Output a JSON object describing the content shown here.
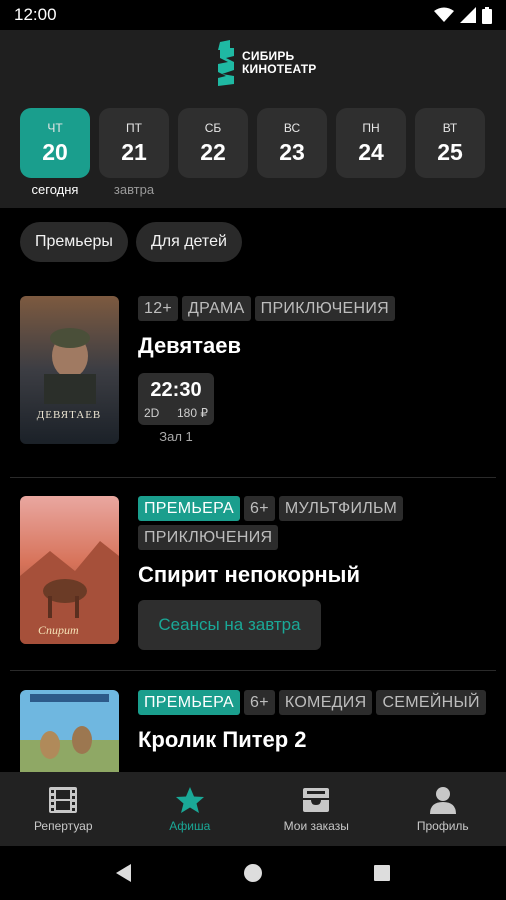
{
  "status": {
    "time": "12:00"
  },
  "logo": {
    "line1": "СИБИРЬ",
    "line2": "КИНОТЕАТР"
  },
  "dates": [
    {
      "dow": "ЧТ",
      "day": "20",
      "caption": "сегодня",
      "active": true
    },
    {
      "dow": "ПТ",
      "day": "21",
      "caption": "завтра",
      "active": false
    },
    {
      "dow": "СБ",
      "day": "22",
      "caption": "",
      "active": false
    },
    {
      "dow": "ВС",
      "day": "23",
      "caption": "",
      "active": false
    },
    {
      "dow": "ПН",
      "day": "24",
      "caption": "",
      "active": false
    },
    {
      "dow": "ВТ",
      "day": "25",
      "caption": "",
      "active": false
    }
  ],
  "filters": [
    "Премьеры",
    "Для детей"
  ],
  "movies": [
    {
      "tags": [
        "12+",
        "ДРАМА",
        "ПРИКЛЮЧЕНИЯ"
      ],
      "title": "Девятаев",
      "session": {
        "time": "22:30",
        "format": "2D",
        "price": "180 ₽",
        "hall": "Зал 1"
      },
      "poster_text": "ДЕВЯТАЕВ"
    },
    {
      "premiere": "ПРЕМЬЕРА",
      "tags": [
        "6+",
        "МУЛЬТФИЛЬМ",
        "ПРИКЛЮЧЕНИЯ"
      ],
      "title": "Спирит непокорный",
      "button": "Сеансы на завтра",
      "poster_text": "Спирит"
    },
    {
      "premiere": "ПРЕМЬЕРА",
      "tags": [
        "6+",
        "КОМЕДИЯ",
        "СЕМЕЙНЫЙ"
      ],
      "title": "Кролик Питер 2"
    }
  ],
  "nav": [
    {
      "label": "Репертуар",
      "icon": "film-icon"
    },
    {
      "label": "Афиша",
      "icon": "star-icon",
      "active": true
    },
    {
      "label": "Мои заказы",
      "icon": "inbox-icon"
    },
    {
      "label": "Профиль",
      "icon": "person-icon"
    }
  ],
  "colors": {
    "accent": "#1a9e8d",
    "header_bg": "#1f1f1f",
    "background": "#000000"
  }
}
